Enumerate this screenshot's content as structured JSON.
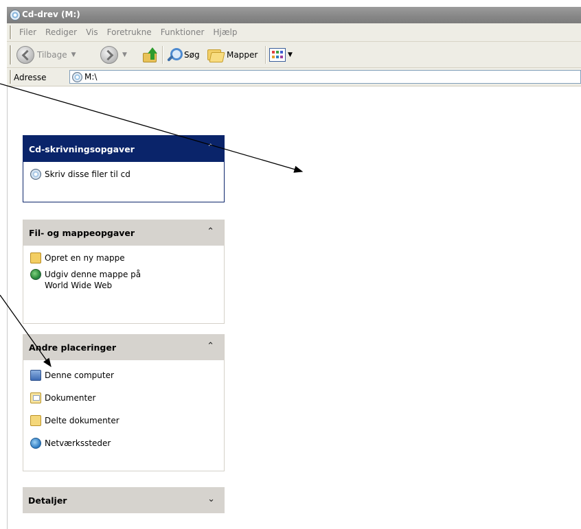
{
  "window": {
    "title": "Cd-drev (M:)"
  },
  "menu": {
    "items": [
      "Filer",
      "Rediger",
      "Vis",
      "Foretrukne",
      "Funktioner",
      "Hjælp"
    ]
  },
  "toolbar": {
    "back_label": "Tilbage",
    "search_label": "Søg",
    "folders_label": "Mapper"
  },
  "address": {
    "label": "Adresse",
    "path": "M:\\"
  },
  "panels": {
    "cd_tasks": {
      "title": "Cd-skrivningsopgaver",
      "items": [
        "Skriv disse filer til cd"
      ]
    },
    "file_tasks": {
      "title": "Fil- og mappeopgaver",
      "items": [
        "Opret en ny mappe",
        "Udgiv denne mappe på",
        "World Wide Web"
      ]
    },
    "other_places": {
      "title": "Andre placeringer",
      "items": [
        "Denne computer",
        "Dokumenter",
        "Delte dokumenter",
        "Netværkssteder"
      ]
    },
    "details": {
      "title": "Detaljer"
    }
  },
  "colors": {
    "task_header_active": "#0a246a",
    "task_header": "#d6d3ce",
    "toolbar": "#eeede5"
  }
}
